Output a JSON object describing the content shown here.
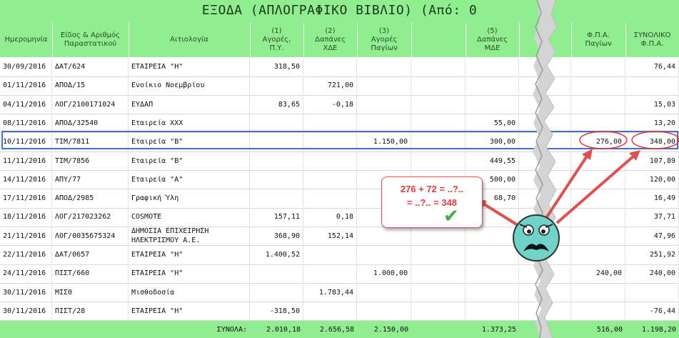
{
  "title": "ΕΞΟΔΑ (ΑΠΛΟΓΡΑΦΙΚΟ ΒΙΒΛΙΟ) (Από: 0",
  "columns": [
    "Ημερομηνία",
    "Είδος & Αριθμός\nΠαραστατικού",
    "Αιτιολογία",
    "(1)\nΑγορές,\nΠ.Υ.",
    "(2)\nΔαπάνες\nΧΔΕ",
    "(3)\nΑγορές\nΠαγίων",
    "",
    "(5)\nΔαπάνες\nΜΔΕ",
    "",
    "",
    "Φ.Π.Α.\nΠαγίων",
    "ΣΥΝΟΛΙΚΟ\nΦ.Π.Α."
  ],
  "rows": [
    [
      "30/09/2016",
      "ΔΑΤ/624",
      "ΕΤΑΙΡΕΙΑ \"Η\"",
      "318,50",
      "",
      "",
      "",
      "",
      "",
      "",
      "",
      "76,44"
    ],
    [
      "01/11/2016",
      "ΑΠΟΔ/15",
      "Ενοίκιο Νοεμβρίου",
      "",
      "721,00",
      "",
      "",
      "",
      "",
      "",
      "",
      ""
    ],
    [
      "04/11/2016",
      "ΛΟΓ/2100171024",
      "ΕΥΔΑΠ",
      "83,65",
      "-0,18",
      "",
      "",
      "",
      "",
      "",
      "",
      "15,03"
    ],
    [
      "08/11/2016",
      "ΑΠΟΔ/32540",
      "Εταιρεία ΧΧΧ",
      "",
      "",
      "",
      "",
      "55,00",
      "",
      "",
      "",
      "13,20"
    ],
    [
      "10/11/2016",
      "ΤΙΜ/7811",
      "Εταιρεία \"Β\"",
      "",
      "",
      "1.150,00",
      "",
      "300,00",
      "",
      "",
      "276,00",
      "348,00"
    ],
    [
      "11/11/2016",
      "ΤΙΜ/7856",
      "Εταιρεία \"Β\"",
      "",
      "",
      "",
      "",
      "449,55",
      "",
      "",
      "",
      "107,89"
    ],
    [
      "14/11/2016",
      "ΑΠΥ/77",
      "Εταιρεία \"Α\"",
      "",
      "",
      "",
      "",
      "500,00",
      "",
      "",
      "",
      "120,00"
    ],
    [
      "17/11/2016",
      "ΑΠΟΔ/2985",
      "Γραφική Ύλη",
      "",
      "",
      "",
      "",
      "68,70",
      "",
      "",
      "",
      "16,49"
    ],
    [
      "18/11/2016",
      "ΛΟΓ/217023262",
      "COSMOTE",
      "157,11",
      "0,18",
      "",
      "",
      "",
      "",
      "",
      "",
      "37,71"
    ],
    [
      "21/11/2016",
      "ΛΟΓ/0035675324",
      "ΔΗΜΟΣΙΑ ΕΠΙΧΕΙΡΗΣΗ ΗΛΕΚΤΡΙΣΜΟΥ Α.Ε.",
      "368,90",
      "152,14",
      "",
      "",
      "",
      "",
      "",
      "",
      "47,96"
    ],
    [
      "22/11/2016",
      "ΔΑΤ/0657",
      "ΕΤΑΙΡΕΙΑ \"Η\"",
      "1.400,52",
      "",
      "",
      "",
      "",
      "",
      "",
      "",
      "251,92"
    ],
    [
      "24/11/2016",
      "ΠΙΣΤ/660",
      "ΕΤΑΙΡΕΙΑ \"Η\"",
      "",
      "",
      "1.000,00",
      "",
      "",
      "",
      "",
      "240,00",
      "240,00"
    ],
    [
      "30/11/2016",
      "ΜΙΣΘ",
      "Μισθοδοσία",
      "",
      "1.783,44",
      "",
      "",
      "",
      "",
      "",
      "",
      ""
    ],
    [
      "30/11/2016",
      "ΠΙΣΤ/28",
      "ΕΤΑΙΡΕΙΑ \"Η\"",
      "-318,50",
      "",
      "",
      "",
      "",
      "",
      "",
      "",
      "-76,44"
    ]
  ],
  "totals": {
    "label": "ΣΥΝΟΛΑ:",
    "col1": "2.010,18",
    "col2": "2.656,58",
    "col3": "2.150,00",
    "col5": "1.373,25",
    "vat_fixed": "516,00",
    "vat_total": "1.198,20"
  },
  "annotation": {
    "line1": "276 + 72 = ..?..",
    "line2": "= ..?.. = 348",
    "check_glyph": "✔",
    "face_icon": "confused-face-icon",
    "accent_color": "#e23b3b",
    "highlight_color": "#4472c4",
    "header_color": "#90ee90"
  }
}
